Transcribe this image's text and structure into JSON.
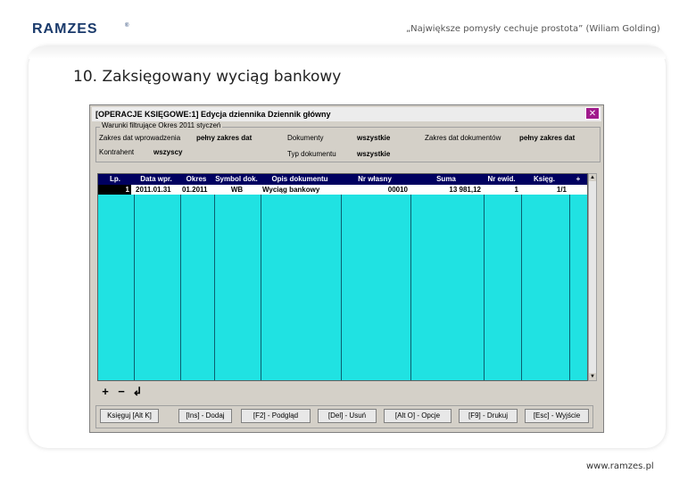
{
  "brand": {
    "name": "RAMZES",
    "color": "#1a3a6b"
  },
  "quote": "„Największe pomysły cechuje prostota” (Wiliam Golding)",
  "slide_title": "10. Zaksięgowany wyciąg bankowy",
  "footer_url": "www.ramzes.pl",
  "window": {
    "title": "[OPERACJE KSIĘGOWE:1] Edycja dziennika Dziennik główny",
    "filter": {
      "legend": "Warunki filtrujące Okres 2011 styczeń",
      "fields": [
        {
          "label": "Zakres dat wprowadzenia",
          "value": "pełny zakres dat"
        },
        {
          "label": "Dokumenty",
          "value": "wszystkie"
        },
        {
          "label": "Zakres dat dokumentów",
          "value": "pełny zakres dat"
        },
        {
          "label": "Kontrahent",
          "value": "wszyscy"
        },
        {
          "label": "Typ dokumentu",
          "value": "wszystkie"
        }
      ]
    },
    "table": {
      "columns": [
        "Lp.",
        "Data wpr.",
        "Okres",
        "Symbol dok.",
        "Opis dokumentu",
        "Nr własny",
        "Suma",
        "Nr ewid.",
        "Księg.",
        "+"
      ],
      "rows": [
        [
          "1",
          "2011.01.31",
          "01.2011",
          "WB",
          "Wyciąg bankowy",
          "00010",
          "13 981,12",
          "1",
          "1/1",
          ""
        ]
      ]
    },
    "toolbar": {
      "add": "+",
      "remove": "−",
      "undo": "↲"
    },
    "buttons": [
      "Księguj [Alt K]",
      "[Ins] - Dodaj",
      "[F2] - Podgląd",
      "[Del] - Usuń",
      "[Alt O] - Opcje",
      "[F9] - Drukuj",
      "[Esc] - Wyjście"
    ]
  }
}
